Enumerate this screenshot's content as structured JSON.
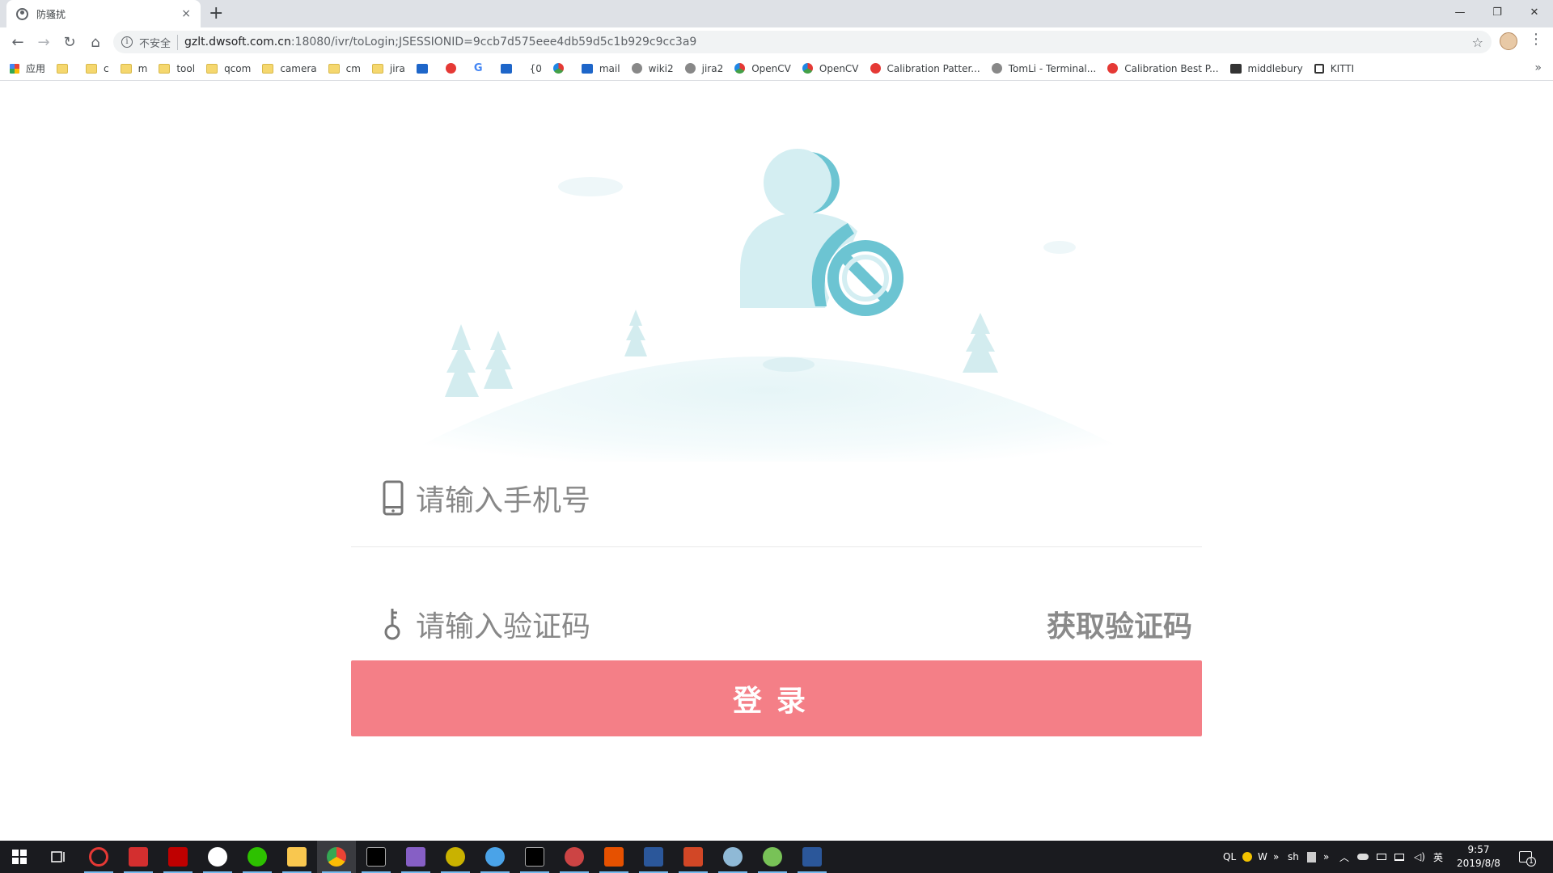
{
  "browser": {
    "tab_title": "防骚扰",
    "tab_close": "×",
    "new_tab": "+",
    "window_controls": {
      "minimize": "—",
      "restore": "❐",
      "close": "✕"
    },
    "nav": {
      "back": "←",
      "forward": "→",
      "reload": "↻",
      "home": "⌂"
    },
    "omnibox": {
      "security_label": "不安全",
      "url_host": "gzlt.dwsoft.com.cn",
      "url_path": ":18080/ivr/toLogin;JSESSIONID=9ccb7d575eee4db59d5c1b929c9cc3a9",
      "star": "☆"
    },
    "menu": "⋮",
    "bookmarks": [
      {
        "label": "应用",
        "icon": "apps-icon"
      },
      {
        "label": "",
        "icon": "folder-icon"
      },
      {
        "label": "c",
        "icon": "folder-icon"
      },
      {
        "label": "m",
        "icon": "folder-icon"
      },
      {
        "label": "tool",
        "icon": "folder-icon"
      },
      {
        "label": "qcom",
        "icon": "folder-icon"
      },
      {
        "label": "camera",
        "icon": "folder-icon"
      },
      {
        "label": "cm",
        "icon": "folder-icon"
      },
      {
        "label": "jira",
        "icon": "folder-icon"
      },
      {
        "label": "",
        "icon": "baidu-icon"
      },
      {
        "label": "",
        "icon": "map-pin-icon"
      },
      {
        "label": "",
        "icon": "google-icon"
      },
      {
        "label": "",
        "icon": "translate-icon"
      },
      {
        "label": "{0",
        "icon": ""
      },
      {
        "label": "",
        "icon": "grid-app-icon"
      },
      {
        "label": "mail",
        "icon": "mail-icon"
      },
      {
        "label": "wiki2",
        "icon": "globe-icon"
      },
      {
        "label": "jira2",
        "icon": "globe-icon"
      },
      {
        "label": "OpenCV",
        "icon": "opencv-icon"
      },
      {
        "label": "OpenCV",
        "icon": "opencv-icon"
      },
      {
        "label": "Calibration Patter...",
        "icon": "red-circle-icon"
      },
      {
        "label": "TomLi - Terminal...",
        "icon": "globe-icon"
      },
      {
        "label": "Calibration Best P...",
        "icon": "red-circle-icon"
      },
      {
        "label": "middlebury",
        "icon": "dark-square-icon"
      },
      {
        "label": "KITTI",
        "icon": "square-outline-icon"
      }
    ],
    "bookmarks_more": "»"
  },
  "login": {
    "phone_placeholder": "请输入手机号",
    "code_placeholder": "请输入验证码",
    "get_code_label": "获取验证码",
    "login_label": "登录"
  },
  "colors": {
    "accent_button": "#f47f87",
    "illustration_teal": "#5ebfcf",
    "illustration_light": "#d4eef2"
  },
  "taskbar": {
    "icons": [
      "windows-start-icon",
      "task-view-icon",
      "app-red-g-icon",
      "app-red-m-icon",
      "filezilla-icon",
      "app-car-icon",
      "wechat-icon",
      "file-explorer-icon",
      "chrome-icon",
      "terminal-icon",
      "visual-studio-icon",
      "app-yellow-icon",
      "app-blue-circle-icon",
      "terminal2-icon",
      "app-globe-icon",
      "app-gear-icon",
      "visio-icon",
      "powerpoint-icon",
      "app-paint-icon",
      "android-studio-icon",
      "word-icon"
    ],
    "tray_text": "QL",
    "tray_w": "W",
    "tray_chevrons": "»",
    "tray_sh": "sh",
    "ime": "英",
    "time": "9:57",
    "date": "2019/8/8",
    "notification_count": "1"
  }
}
